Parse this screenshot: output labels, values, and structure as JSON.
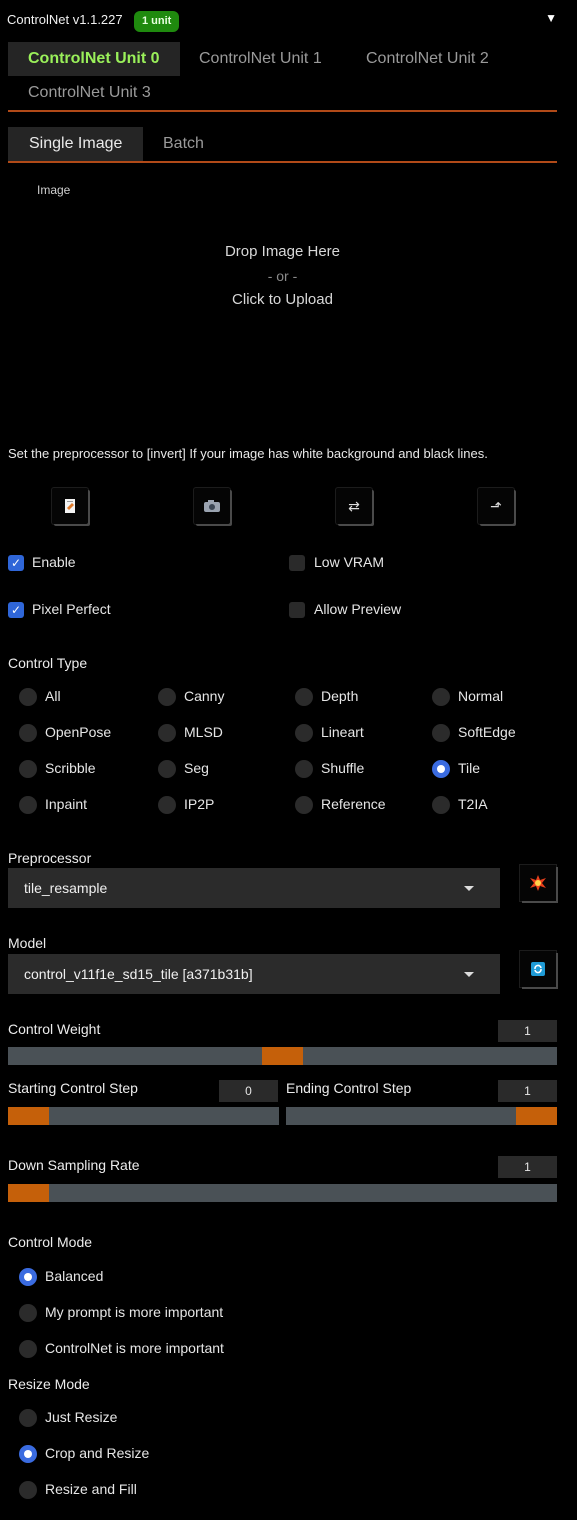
{
  "header": {
    "title": "ControlNet v1.1.227",
    "badge": "1 unit",
    "collapse_icon": "triangle-down"
  },
  "unit_tabs": [
    "ControlNet Unit 0",
    "ControlNet Unit 1",
    "ControlNet Unit 2",
    "ControlNet Unit 3"
  ],
  "image_tabs": [
    "Single Image",
    "Batch"
  ],
  "image_label": "Image",
  "drop": {
    "line1": "Drop Image Here",
    "line2": "- or -",
    "line3": "Click to Upload"
  },
  "hint": "Set the preprocessor to [invert] If your image has white background and black lines.",
  "tools": [
    "document-icon",
    "camera-icon",
    "swap-icon",
    "send-up-icon"
  ],
  "checkboxes": {
    "enable": {
      "label": "Enable",
      "checked": true
    },
    "low_vram": {
      "label": "Low VRAM",
      "checked": false
    },
    "pixel_perfect": {
      "label": "Pixel Perfect",
      "checked": true
    },
    "allow_preview": {
      "label": "Allow Preview",
      "checked": false
    }
  },
  "control_type": {
    "label": "Control Type",
    "options": [
      "All",
      "Canny",
      "Depth",
      "Normal",
      "OpenPose",
      "MLSD",
      "Lineart",
      "SoftEdge",
      "Scribble",
      "Seg",
      "Shuffle",
      "Tile",
      "Inpaint",
      "IP2P",
      "Reference",
      "T2IA"
    ],
    "selected": "Tile"
  },
  "preprocessor": {
    "label": "Preprocessor",
    "value": "tile_resample",
    "button_icon": "explosion-icon"
  },
  "model": {
    "label": "Model",
    "value": "control_v11f1e_sd15_tile [a371b31b]",
    "button_icon": "refresh-icon"
  },
  "control_weight": {
    "label": "Control Weight",
    "value": "1",
    "fraction": 0.5
  },
  "starting_step": {
    "label": "Starting Control Step",
    "value": "0",
    "fraction": 0
  },
  "ending_step": {
    "label": "Ending Control Step",
    "value": "1",
    "fraction": 1
  },
  "down_sampling": {
    "label": "Down Sampling Rate",
    "value": "1",
    "fraction": 0
  },
  "control_mode": {
    "label": "Control Mode",
    "options": [
      "Balanced",
      "My prompt is more important",
      "ControlNet is more important"
    ],
    "selected": "Balanced"
  },
  "resize_mode": {
    "label": "Resize Mode",
    "options": [
      "Just Resize",
      "Crop and Resize",
      "Resize and Fill"
    ],
    "selected": "Crop and Resize"
  },
  "colors": {
    "accent": "#c5600a",
    "active_tab_text": "#9af05a",
    "badge": "#1f8a0e",
    "checkbox": "#2f66d8"
  }
}
